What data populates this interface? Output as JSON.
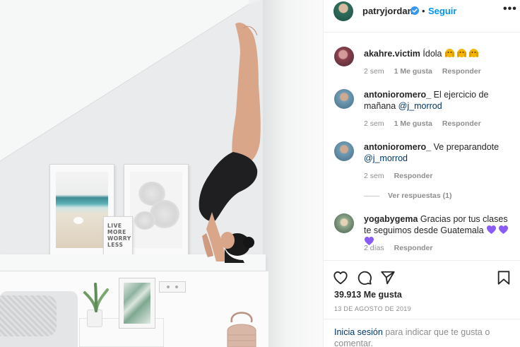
{
  "header": {
    "username": "patryjordan",
    "separator": "•",
    "follow_label": "Seguir",
    "more_label": "•••"
  },
  "comments": [
    {
      "user": "akahre.victim",
      "text": "Ídola",
      "emoji_count": 3,
      "emoji": "face-with-hands-icon",
      "time": "2 sem",
      "likes": "1 Me gusta",
      "reply": "Responder"
    },
    {
      "user": "antonioromero_",
      "text": "El ejercicio de mañana",
      "mention": "@j_morrod",
      "time": "2 sem",
      "likes": "1 Me gusta",
      "reply": "Responder"
    },
    {
      "user": "antonioromero_",
      "text": "Ve preparandote",
      "mention": "@j_morrod",
      "time": "2 sem",
      "reply": "Responder",
      "view_replies": "Ver respuestas (1)"
    },
    {
      "user": "yogabygema",
      "text": "Gracias por tus clases te seguimos desde Guatemala",
      "emoji_count": 3,
      "emoji": "purple-heart-icon",
      "time": "2 días",
      "reply": "Responder"
    }
  ],
  "post": {
    "likes": "39.913 Me gusta",
    "date": "13 DE AGOSTO DE 2019",
    "login_link": "Inicia sesión",
    "login_text": " para indicar que te gusta o comentar."
  },
  "artwork": {
    "poster_text": [
      "LIVE",
      "MORE",
      "WORRY",
      "LESS"
    ]
  },
  "colors": {
    "accent": "#0095f6",
    "verified": "#3897f0",
    "mention": "#00376b",
    "heart": "#8a5cf5"
  }
}
